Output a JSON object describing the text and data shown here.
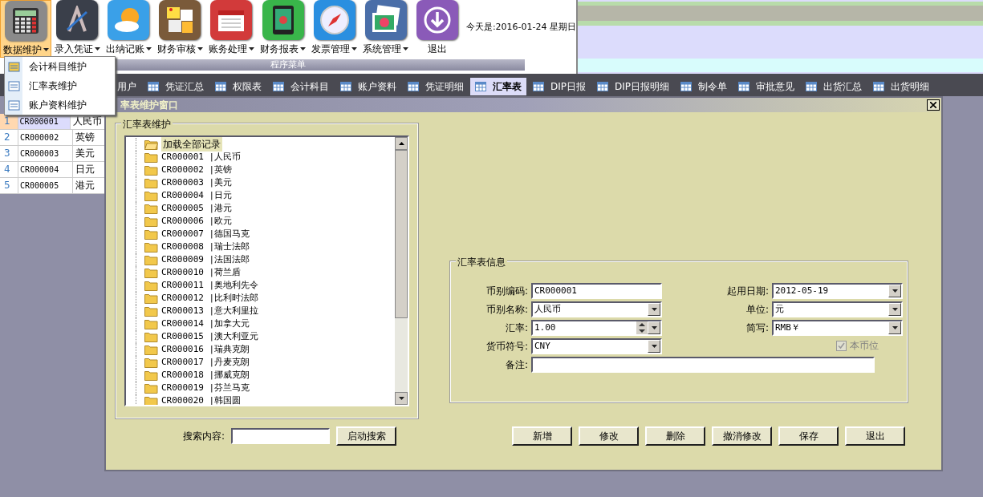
{
  "toolbar": {
    "items": [
      {
        "label": "数据维护",
        "has_dropdown": true,
        "selected": true
      },
      {
        "label": "录入凭证",
        "has_dropdown": true,
        "selected": false
      },
      {
        "label": "出纳记账",
        "has_dropdown": true,
        "selected": false
      },
      {
        "label": "财务审核",
        "has_dropdown": true,
        "selected": false
      },
      {
        "label": "账务处理",
        "has_dropdown": true,
        "selected": false
      },
      {
        "label": "财务报表",
        "has_dropdown": true,
        "selected": false
      },
      {
        "label": "发票管理",
        "has_dropdown": true,
        "selected": false
      },
      {
        "label": "系统管理",
        "has_dropdown": true,
        "selected": false
      },
      {
        "label": "退出",
        "has_dropdown": false,
        "selected": false
      }
    ],
    "date_text": "今天是:2016-01-24 星期日",
    "group_label": "程序菜单"
  },
  "dropdown_menu": {
    "items": [
      {
        "label": "会计科目维护"
      },
      {
        "label": "汇率表维护"
      },
      {
        "label": "账户资料维护"
      }
    ]
  },
  "tabs": [
    {
      "label": "用户",
      "selected": false
    },
    {
      "label": "凭证汇总",
      "selected": false
    },
    {
      "label": "权限表",
      "selected": false
    },
    {
      "label": "会计科目",
      "selected": false
    },
    {
      "label": "账户资料",
      "selected": false
    },
    {
      "label": "凭证明细",
      "selected": false
    },
    {
      "label": "汇率表",
      "selected": true
    },
    {
      "label": "DIP日报",
      "selected": false
    },
    {
      "label": "DIP日报明细",
      "selected": false
    },
    {
      "label": "制令单",
      "selected": false
    },
    {
      "label": "审批意见",
      "selected": false
    },
    {
      "label": "出货汇总",
      "selected": false
    },
    {
      "label": "出货明细",
      "selected": false
    }
  ],
  "grid": {
    "rows": [
      {
        "number": "1",
        "code": "CR000001",
        "name": "人民币",
        "selected": true
      },
      {
        "number": "2",
        "code": "CR000002",
        "name": "英镑",
        "selected": false
      },
      {
        "number": "3",
        "code": "CR000003",
        "name": "美元",
        "selected": false
      },
      {
        "number": "4",
        "code": "CR000004",
        "name": "日元",
        "selected": false
      },
      {
        "number": "5",
        "code": "CR000005",
        "name": "港元",
        "selected": false
      }
    ]
  },
  "window": {
    "title": "率表维护窗口",
    "tree_group": {
      "label": "汇率表维护",
      "root": {
        "label": "加载全部记录",
        "selected": true,
        "children": [
          {
            "label": "CR000001 |人民币"
          },
          {
            "label": "CR000002 |英镑"
          },
          {
            "label": "CR000003 |美元"
          },
          {
            "label": "CR000004 |日元"
          },
          {
            "label": "CR000005 |港元"
          },
          {
            "label": "CR000006 |欧元"
          },
          {
            "label": "CR000007 |德国马克"
          },
          {
            "label": "CR000008 |瑞士法郎"
          },
          {
            "label": "CR000009 |法国法郎"
          },
          {
            "label": "CR000010 |荷兰盾"
          },
          {
            "label": "CR000011 |奥地利先令"
          },
          {
            "label": "CR000012 |比利时法郎"
          },
          {
            "label": "CR000013 |意大利里拉"
          },
          {
            "label": "CR000014 |加拿大元"
          },
          {
            "label": "CR000015 |澳大利亚元"
          },
          {
            "label": "CR000016 |瑞典克朗"
          },
          {
            "label": "CR000017 |丹麦克朗"
          },
          {
            "label": "CR000018 |挪威克朗"
          },
          {
            "label": "CR000019 |芬兰马克"
          },
          {
            "label": "CR000020 |韩国圆"
          }
        ]
      }
    },
    "info_group": {
      "label": "汇率表信息",
      "fields": [
        {
          "label": "币别编码:",
          "value": "CR000001",
          "kind": "text"
        },
        {
          "label": "起用日期:",
          "value": "2012-05-19",
          "kind": "combo"
        },
        {
          "label": "币别名称:",
          "value": "人民币",
          "kind": "combo"
        },
        {
          "label": "单位:",
          "value": "元",
          "kind": "combo"
        },
        {
          "label": "汇率:",
          "value": "1.00",
          "kind": "spin"
        },
        {
          "label": "简写:",
          "value": "RMB￥",
          "kind": "combo"
        },
        {
          "label": "货币符号:",
          "value": "CNY",
          "kind": "combo"
        },
        {
          "label": "本币位",
          "checked": true,
          "disabled": true,
          "kind": "checkbox"
        },
        {
          "label": "备注:",
          "kind": "wide"
        }
      ]
    },
    "search": {
      "label": "搜索内容:",
      "button": "启动搜索"
    },
    "buttons": [
      "新增",
      "修改",
      "删除",
      "撤消修改",
      "保存",
      "退出"
    ]
  }
}
